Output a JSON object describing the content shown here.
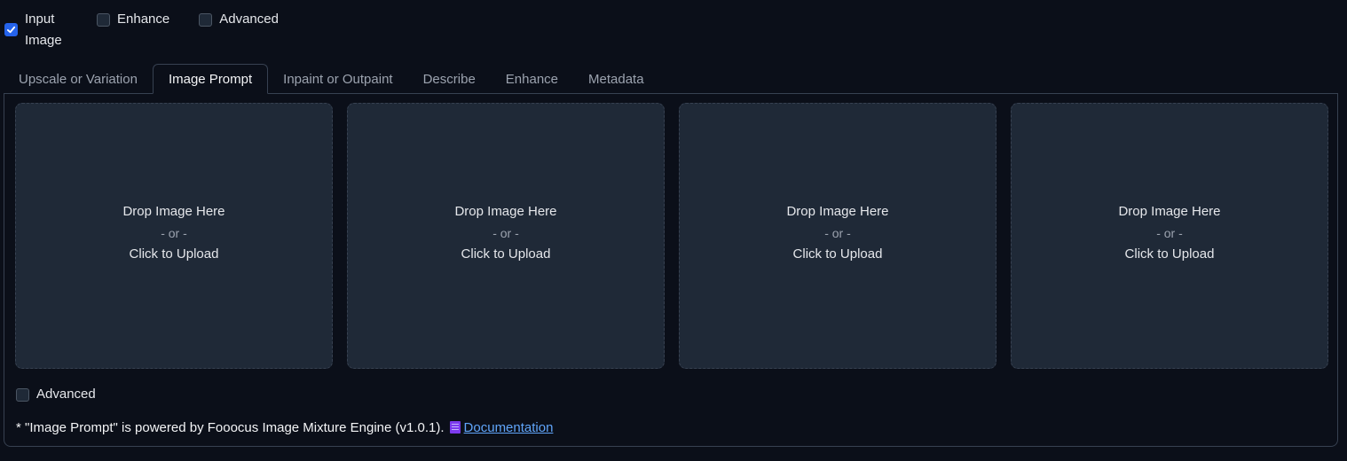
{
  "top_checkboxes": [
    {
      "label": "Input Image",
      "checked": true
    },
    {
      "label": "Enhance",
      "checked": false
    },
    {
      "label": "Advanced",
      "checked": false
    }
  ],
  "tabs": [
    {
      "label": "Upscale or Variation",
      "active": false
    },
    {
      "label": "Image Prompt",
      "active": true
    },
    {
      "label": "Inpaint or Outpaint",
      "active": false
    },
    {
      "label": "Describe",
      "active": false
    },
    {
      "label": "Enhance",
      "active": false
    },
    {
      "label": "Metadata",
      "active": false
    }
  ],
  "upload_boxes": [
    {
      "drop": "Drop Image Here",
      "or": "- or -",
      "click": "Click to Upload"
    },
    {
      "drop": "Drop Image Here",
      "or": "- or -",
      "click": "Click to Upload"
    },
    {
      "drop": "Drop Image Here",
      "or": "- or -",
      "click": "Click to Upload"
    },
    {
      "drop": "Drop Image Here",
      "or": "- or -",
      "click": "Click to Upload"
    }
  ],
  "panel_advanced": {
    "label": "Advanced",
    "checked": false
  },
  "footnote": {
    "text": "* \"Image Prompt\" is powered by Fooocus Image Mixture Engine (v1.0.1).",
    "link_label": "Documentation",
    "book_icon": "book-icon"
  },
  "colors": {
    "background": "#0b0f19",
    "accent": "#2563eb",
    "upload_box": "#1f2937",
    "link": "#60a5fa"
  }
}
